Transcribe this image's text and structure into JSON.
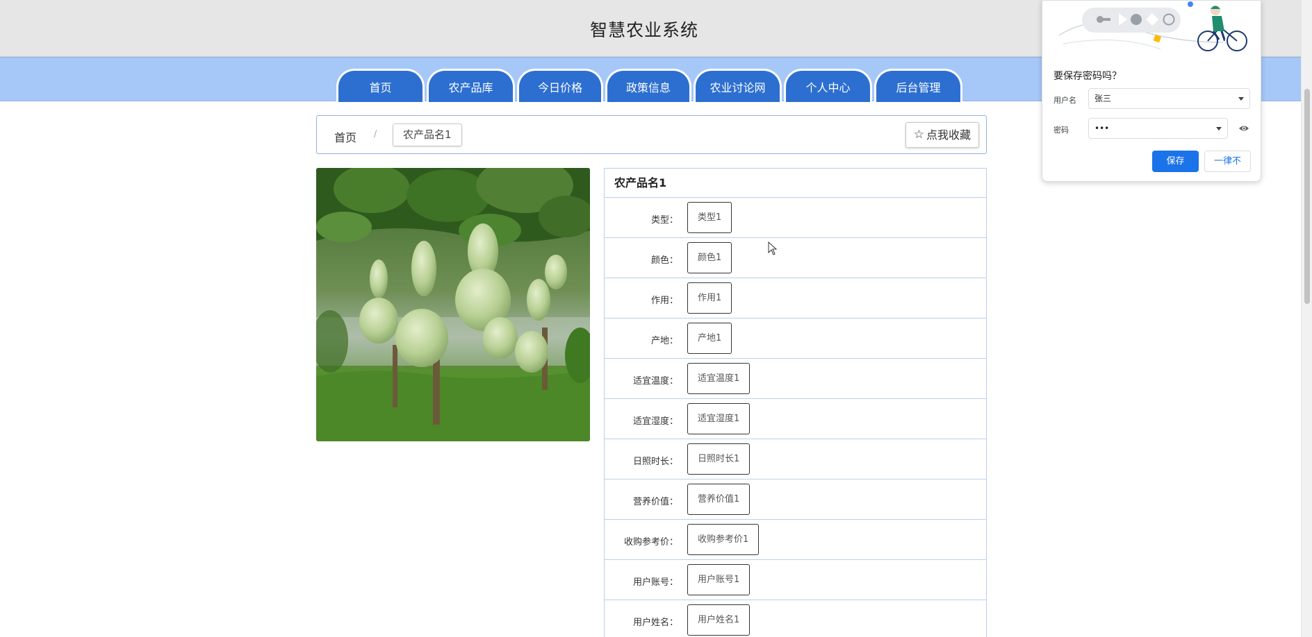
{
  "header": {
    "title": "智慧农业系统"
  },
  "nav": {
    "tabs": [
      {
        "label": "首页"
      },
      {
        "label": "农产品库"
      },
      {
        "label": "今日价格"
      },
      {
        "label": "政策信息"
      },
      {
        "label": "农业讨论网"
      },
      {
        "label": "个人中心"
      },
      {
        "label": "后台管理"
      }
    ]
  },
  "breadcrumb": {
    "home": "首页",
    "separator": "/",
    "current": "农产品名1"
  },
  "favorite_button": {
    "icon": "star-outline-icon",
    "label": "点我收藏"
  },
  "product": {
    "name": "农产品名1",
    "image_subject": "bottle gourds hanging under a trellis",
    "fields": [
      {
        "label": "类型：",
        "value": "类型1"
      },
      {
        "label": "颜色：",
        "value": "颜色1"
      },
      {
        "label": "作用：",
        "value": "作用1"
      },
      {
        "label": "产地：",
        "value": "产地1"
      },
      {
        "label": "适宜温度：",
        "value": "适宜温度1"
      },
      {
        "label": "适宜湿度：",
        "value": "适宜湿度1"
      },
      {
        "label": "日照时长：",
        "value": "日照时长1"
      },
      {
        "label": "营养价值：",
        "value": "营养价值1"
      },
      {
        "label": "收购参考价：",
        "value": "收购参考价1"
      },
      {
        "label": "用户账号：",
        "value": "用户账号1"
      },
      {
        "label": "用户姓名：",
        "value": "用户姓名1"
      }
    ]
  },
  "password_prompt": {
    "title": "要保存密码吗？",
    "username_label": "用户名",
    "username_value": "张三",
    "password_label": "密码",
    "password_value": "•••",
    "save_label": "保存",
    "never_label": "一律不"
  },
  "colors": {
    "nav_tab": "#2d6fd0",
    "nav_bar": "#a6c8f8",
    "header": "#e6e6e6",
    "border": "#b9cfee",
    "chrome_blue": "#1a73e8"
  }
}
